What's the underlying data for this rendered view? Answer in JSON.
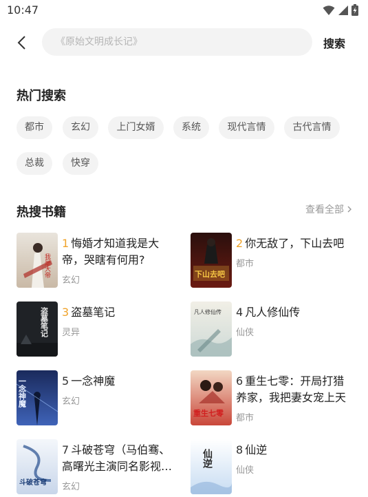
{
  "status": {
    "time": "10:47"
  },
  "search": {
    "placeholder": "《原始文明成长记》",
    "button": "搜索"
  },
  "hot_search": {
    "title": "热门搜索",
    "tags": [
      "都市",
      "玄幻",
      "上门女婿",
      "系统",
      "现代言情",
      "古代言情",
      "总裁",
      "快穿"
    ]
  },
  "hot_books": {
    "title": "热搜书籍",
    "view_all": "查看全部",
    "items": [
      {
        "rank": "1",
        "title": "悔婚才知道我是大帝，哭瞎有何用?",
        "category": "玄幻",
        "cover_text": "我是大帝"
      },
      {
        "rank": "2",
        "title": "你无敌了，下山去吧",
        "category": "都市",
        "cover_text": "下山去吧"
      },
      {
        "rank": "3",
        "title": "盗墓笔记",
        "category": "灵异",
        "cover_text": "盗墓笔记"
      },
      {
        "rank": "4",
        "title": "凡人修仙传",
        "category": "仙侠",
        "cover_text": "凡人修仙传"
      },
      {
        "rank": "5",
        "title": "一念神魔",
        "category": "玄幻",
        "cover_text": "一念神魔"
      },
      {
        "rank": "6",
        "title": "重生七零：开局打猎养家，我把妻女宠上天",
        "category": "都市",
        "cover_text": "重生七零"
      },
      {
        "rank": "7",
        "title": "斗破苍穹（马伯骞、高曙光主演同名影视剧原著）",
        "category": "玄幻",
        "cover_text": "斗破苍穹"
      },
      {
        "rank": "8",
        "title": "仙逆",
        "category": "仙侠",
        "cover_text": "仙逆"
      }
    ]
  },
  "colors": {
    "accent_rank": "#f0a32a",
    "tag_bg": "#f3f3f3",
    "search_bg": "#f3f3f3"
  }
}
